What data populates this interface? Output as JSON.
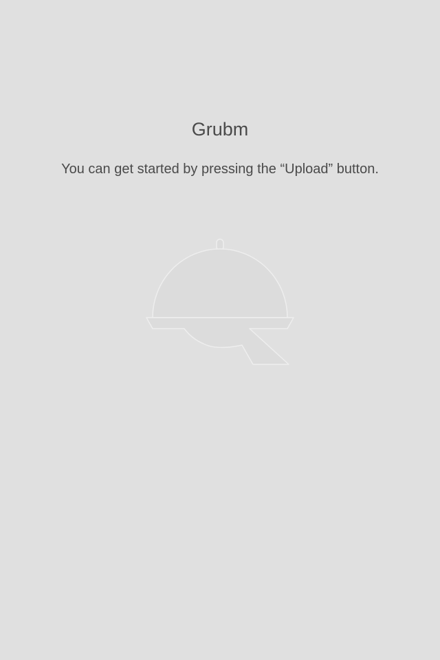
{
  "app": {
    "title": "Grubm"
  },
  "empty_state": {
    "message": "You can get started by pressing the “Upload” button.",
    "illustration_icon": "cloche-icon"
  },
  "colors": {
    "background": "#e0e0e0",
    "text": "#4a4a4a",
    "illustration_fill": "#dddddd",
    "illustration_highlight": "#efefef"
  }
}
